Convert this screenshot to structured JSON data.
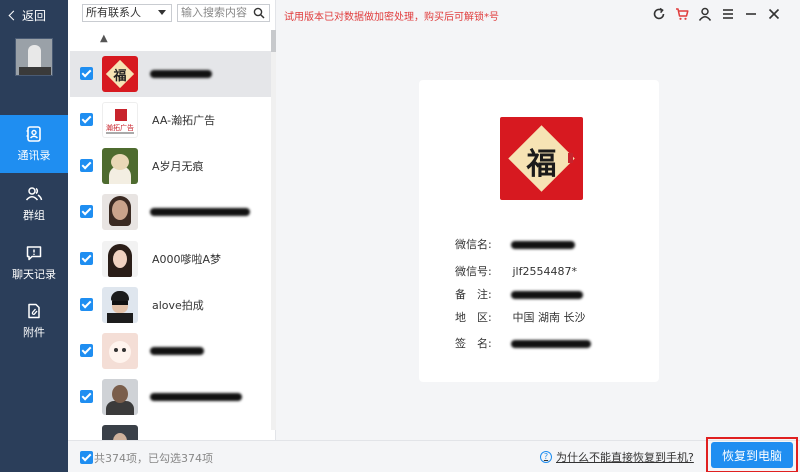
{
  "nav": {
    "back_label": "返回",
    "items": [
      {
        "label": "通讯录",
        "icon": "contacts-icon",
        "active": true
      },
      {
        "label": "群组",
        "icon": "group-icon",
        "active": false
      },
      {
        "label": "聊天记录",
        "icon": "chat-icon",
        "active": false
      },
      {
        "label": "附件",
        "icon": "attachment-icon",
        "active": false
      }
    ]
  },
  "toolbar": {
    "filter_value": "所有联系人",
    "search_placeholder": "输入搜索内容",
    "notice": "试用版本已对数据做加密处理，购买后可解锁*号"
  },
  "list": {
    "index_letter": "▲",
    "contacts": [
      {
        "name": "",
        "avatar": "fu",
        "selected": true,
        "checked": true
      },
      {
        "name": "AA-瀚拓广告",
        "avatar": "logo",
        "checked": true
      },
      {
        "name": "A岁月无痕",
        "avatar": "bear",
        "checked": true
      },
      {
        "name": "",
        "avatar": "person1",
        "checked": true
      },
      {
        "name": "A000嗲啦A梦",
        "avatar": "person2",
        "checked": true
      },
      {
        "name": "alove拍成",
        "avatar": "man",
        "checked": true
      },
      {
        "name": "",
        "avatar": "cat",
        "checked": true
      },
      {
        "name": "",
        "avatar": "dark",
        "checked": true
      }
    ]
  },
  "detail": {
    "rows": [
      {
        "label": "微信名:",
        "value": ""
      },
      {
        "label": "微信号:",
        "value": "jlf2554487*"
      },
      {
        "label": "备　注:",
        "value": ""
      },
      {
        "label": "地　区:",
        "value": "中国 湖南 长沙"
      },
      {
        "label": "签　名:",
        "value": ""
      }
    ]
  },
  "bottom": {
    "count_text": "共374项，已勾选374项",
    "help_text": "为什么不能直接恢复到手机?",
    "restore_label": "恢复到电脑"
  },
  "avatar_glyph": "福",
  "colors": {
    "nav_bg": "#2b3e5a",
    "accent": "#1f8ef1",
    "notice": "#e03c3c",
    "highlight_frame": "#e02020"
  }
}
